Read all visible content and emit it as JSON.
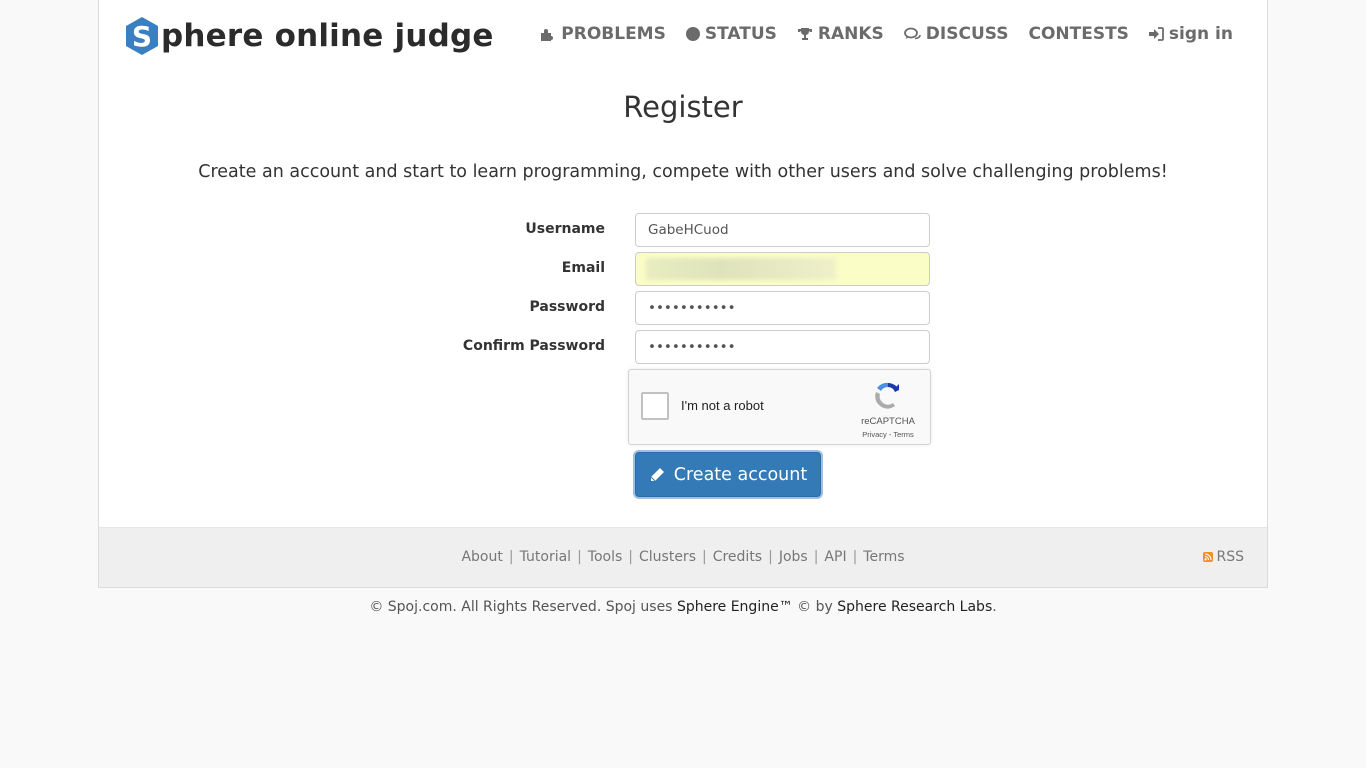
{
  "header": {
    "logo_letter": "S",
    "logo_text": "phere online judge",
    "nav": [
      {
        "label": "PROBLEMS",
        "icon": "puzzle-icon"
      },
      {
        "label": "STATUS",
        "icon": "circle-icon"
      },
      {
        "label": "RANKS",
        "icon": "trophy-icon"
      },
      {
        "label": "DISCUSS",
        "icon": "comments-icon"
      },
      {
        "label": "CONTESTS",
        "icon": ""
      },
      {
        "label": "sign in",
        "icon": "sign-in-icon"
      }
    ]
  },
  "main": {
    "title": "Register",
    "lead": "Create an account and start to learn programming, compete with other users and solve challenging problems!",
    "form": {
      "username_label": "Username",
      "username_value": "GabeHCuod",
      "email_label": "Email",
      "email_value": "",
      "password_label": "Password",
      "password_value": "•••••••••••",
      "confirm_label": "Confirm Password",
      "confirm_value": "•••••••••••"
    },
    "captcha": {
      "label": "I'm not a robot",
      "brand": "reCAPTCHA",
      "links": "Privacy - Terms"
    },
    "submit_label": "Create account"
  },
  "footer": {
    "links": [
      "About",
      "Tutorial",
      "Tools",
      "Clusters",
      "Credits",
      "Jobs",
      "API",
      "Terms"
    ],
    "rss_label": "RSS"
  },
  "copyright": {
    "prefix": "© Spoj.com. All Rights Reserved. Spoj uses ",
    "engine": "Sphere Engine™",
    "mid": " © by ",
    "labs": "Sphere Research Labs",
    "suffix": "."
  },
  "colors": {
    "accent": "#337ab7",
    "logo_blue": "#3a7fc1",
    "autofill": "#fafdc6"
  }
}
